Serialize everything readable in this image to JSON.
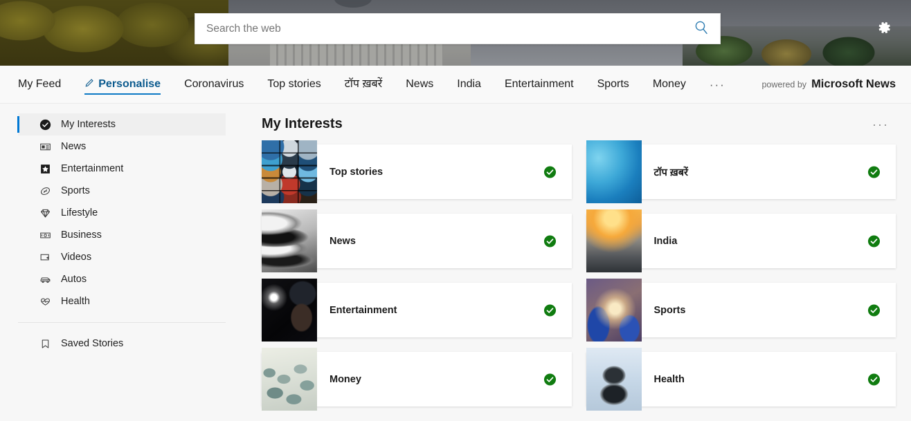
{
  "header": {
    "search": {
      "placeholder": "Search the web",
      "value": "",
      "icon": "search-icon"
    },
    "settings_icon": "gear-icon"
  },
  "navbar": {
    "items": [
      {
        "label": "My Feed",
        "active": false,
        "icon": null
      },
      {
        "label": "Personalise",
        "active": true,
        "icon": "pencil-icon"
      },
      {
        "label": "Coronavirus",
        "active": false,
        "icon": null
      },
      {
        "label": "Top stories",
        "active": false,
        "icon": null
      },
      {
        "label": "टॉप ख़बरें",
        "active": false,
        "icon": null
      },
      {
        "label": "News",
        "active": false,
        "icon": null
      },
      {
        "label": "India",
        "active": false,
        "icon": null
      },
      {
        "label": "Entertainment",
        "active": false,
        "icon": null
      },
      {
        "label": "Sports",
        "active": false,
        "icon": null
      },
      {
        "label": "Money",
        "active": false,
        "icon": null
      },
      {
        "label": "···",
        "active": false,
        "icon": "overflow-icon"
      }
    ],
    "powered_by_label": "powered by",
    "brand": "Microsoft News",
    "accent_color": "#0b78c4"
  },
  "sidebar": {
    "items": [
      {
        "label": "My Interests",
        "icon": "check-circle-icon",
        "active": true
      },
      {
        "label": "News",
        "icon": "newspaper-icon",
        "active": false
      },
      {
        "label": "Entertainment",
        "icon": "star-icon",
        "active": false
      },
      {
        "label": "Sports",
        "icon": "football-icon",
        "active": false
      },
      {
        "label": "Lifestyle",
        "icon": "diamond-icon",
        "active": false
      },
      {
        "label": "Business",
        "icon": "money-icon",
        "active": false
      },
      {
        "label": "Videos",
        "icon": "video-icon",
        "active": false
      },
      {
        "label": "Autos",
        "icon": "car-icon",
        "active": false
      },
      {
        "label": "Health",
        "icon": "heart-pulse-icon",
        "active": false
      }
    ],
    "footer_items": [
      {
        "label": "Saved Stories",
        "icon": "bookmark-icon"
      }
    ]
  },
  "main": {
    "title": "My Interests",
    "overflow_label": "···",
    "selected_color": "#107c10",
    "cards": [
      {
        "label": "Top stories",
        "thumb": "t-topstories",
        "selected": true,
        "check_icon": "check-circle-filled-icon"
      },
      {
        "label": "टॉप ख़बरें",
        "thumb": "t-topkhabre",
        "selected": true,
        "check_icon": "check-circle-filled-icon"
      },
      {
        "label": "News",
        "thumb": "t-news",
        "selected": true,
        "check_icon": "check-circle-filled-icon"
      },
      {
        "label": "India",
        "thumb": "t-india",
        "selected": true,
        "check_icon": "check-circle-filled-icon"
      },
      {
        "label": "Entertainment",
        "thumb": "t-entertainment",
        "selected": true,
        "check_icon": "check-circle-filled-icon"
      },
      {
        "label": "Sports",
        "thumb": "t-sports",
        "selected": true,
        "check_icon": "check-circle-filled-icon"
      },
      {
        "label": "Money",
        "thumb": "t-money",
        "selected": true,
        "check_icon": "check-circle-filled-icon"
      },
      {
        "label": "Health",
        "thumb": "t-health",
        "selected": true,
        "check_icon": "check-circle-filled-icon"
      }
    ]
  }
}
